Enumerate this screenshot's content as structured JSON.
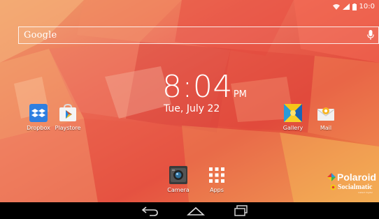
{
  "status_bar": {
    "time": "10:0",
    "icons": [
      "wifi-icon",
      "signal-icon",
      "battery-icon"
    ]
  },
  "search": {
    "label": "Google",
    "icon": "mic-icon"
  },
  "clock": {
    "time": "8:04",
    "ampm": "PM",
    "date": "Tue, July 22"
  },
  "apps": {
    "dropbox": "Dropbox",
    "playstore": "Playstore",
    "gallery": "Gallery",
    "mail": "Mail",
    "camera": "Camera",
    "apps": "Apps"
  },
  "brand": {
    "name": "Polaroid",
    "product": "Socialmatic",
    "tagline": "instant digital"
  },
  "colors": {
    "wallpaper_red": "#e8563e",
    "wallpaper_orange": "#f39a52",
    "wallpaper_pink": "#ee7b72",
    "dropbox_blue": "#2f7fe0",
    "navbar": "#000000"
  },
  "nav": [
    "back-icon",
    "home-icon",
    "recents-icon"
  ]
}
